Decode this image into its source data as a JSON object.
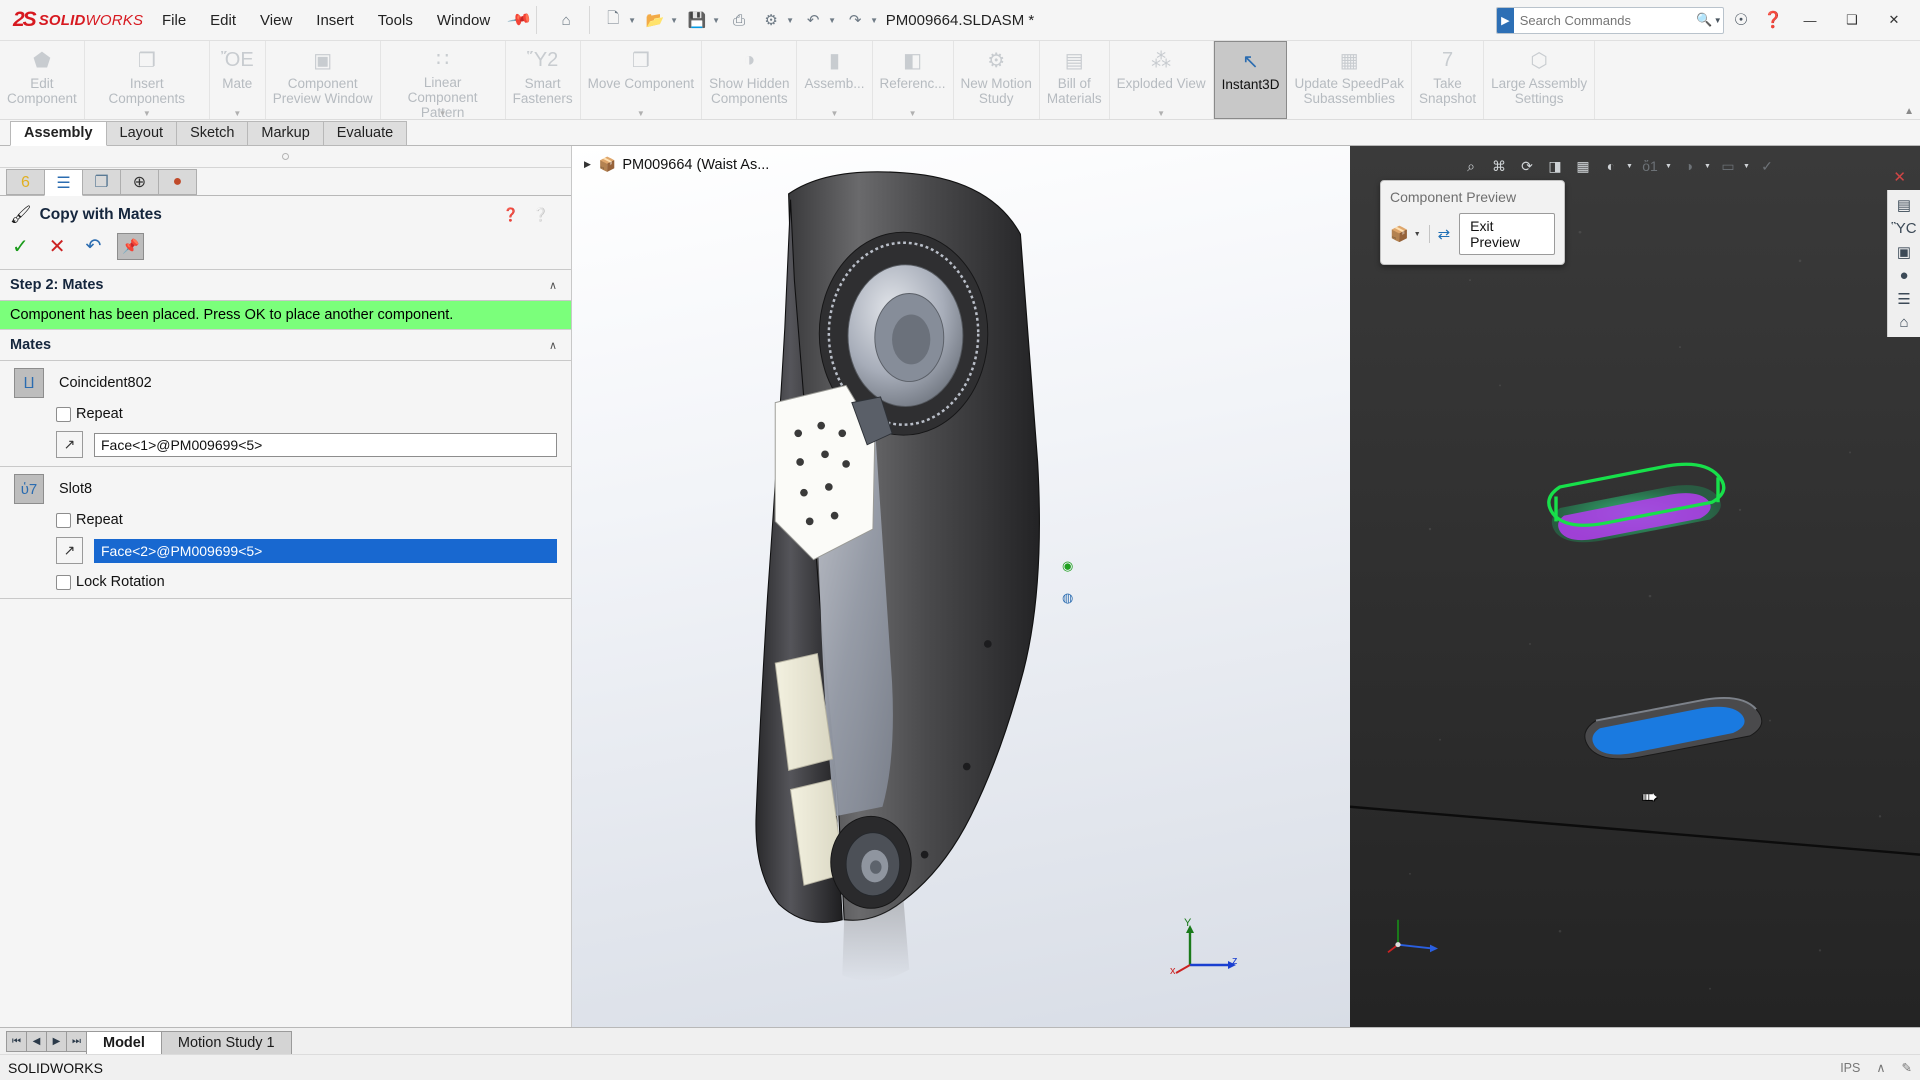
{
  "app": {
    "brand_mark": "2S",
    "brand_bold": "SOLID",
    "brand_light": "WORKS",
    "document_title": "PM009664.SLDASM *",
    "accent_color": "#d71920",
    "selection_color": "#1868d0",
    "status_color": "#7bff7b"
  },
  "menu": {
    "items": [
      {
        "label": "File"
      },
      {
        "label": "Edit"
      },
      {
        "label": "View"
      },
      {
        "label": "Insert"
      },
      {
        "label": "Tools"
      },
      {
        "label": "Window"
      }
    ],
    "pin_icon": "pushpin-icon"
  },
  "quick_access": [
    {
      "name": "home-icon",
      "glyph": "⌂",
      "caret": false
    },
    {
      "name": "new-document-icon",
      "glyph": "❐",
      "caret": true
    },
    {
      "name": "open-folder-icon",
      "glyph": "Ὄ2",
      "caret": true
    },
    {
      "name": "save-icon",
      "glyph": "ὋE",
      "caret": true
    },
    {
      "name": "print-icon",
      "glyph": "⎙",
      "caret": false
    },
    {
      "name": "options-gear-icon",
      "glyph": "⚙",
      "caret": true
    },
    {
      "name": "undo-icon",
      "glyph": "↶",
      "caret": true
    },
    {
      "name": "redo-icon",
      "glyph": "↷",
      "caret": true
    }
  ],
  "search": {
    "placeholder": "Search Commands",
    "magnifier_icon": "search-icon",
    "dropdown_icon": "chevron-down-icon",
    "go_icon": "search-go-icon"
  },
  "window_controls": {
    "account_icon": "user-account-icon",
    "help_icon": "help-icon",
    "minimize": "—",
    "maximize": "❑",
    "close": "✕"
  },
  "ribbon": {
    "buttons": [
      {
        "label": "Edit\nComponent",
        "icon": "edit-component-icon",
        "glyph": "⬟",
        "caret": false,
        "active": false
      },
      {
        "label": "Insert Components",
        "icon": "insert-components-icon",
        "glyph": "❐",
        "caret": true,
        "active": false
      },
      {
        "label": "Mate",
        "icon": "mate-icon",
        "glyph": "ὌE",
        "caret": true,
        "active": false
      },
      {
        "label": "Component\nPreview Window",
        "icon": "component-preview-window-icon",
        "glyph": "▣",
        "caret": false,
        "active": false
      },
      {
        "label": "Linear Component Pattern",
        "icon": "linear-component-pattern-icon",
        "glyph": "∷",
        "caret": true,
        "active": false
      },
      {
        "label": "Smart\nFasteners",
        "icon": "smart-fasteners-icon",
        "glyph": "Ὕ2",
        "caret": false,
        "active": false
      },
      {
        "label": "Move Component",
        "icon": "move-component-icon",
        "glyph": "❐",
        "caret": true,
        "active": false
      },
      {
        "label": "Show Hidden\nComponents",
        "icon": "show-hidden-components-icon",
        "glyph": "◑",
        "caret": false,
        "active": false
      },
      {
        "label": "Assemb...",
        "icon": "assembly-features-icon",
        "glyph": "▮",
        "caret": true,
        "active": false
      },
      {
        "label": "Referenc...",
        "icon": "reference-geometry-icon",
        "glyph": "◧",
        "caret": true,
        "active": false
      },
      {
        "label": "New Motion\nStudy",
        "icon": "new-motion-study-icon",
        "glyph": "⚙",
        "caret": false,
        "active": false
      },
      {
        "label": "Bill of\nMaterials",
        "icon": "bill-of-materials-icon",
        "glyph": "▤",
        "caret": false,
        "active": false
      },
      {
        "label": "Exploded View",
        "icon": "exploded-view-icon",
        "glyph": "⁂",
        "caret": true,
        "active": false
      },
      {
        "label": "Instant3D",
        "icon": "instant3d-icon",
        "glyph": "↖",
        "caret": false,
        "active": true
      },
      {
        "label": "Update SpeedPak\nSubassemblies",
        "icon": "update-speedpak-icon",
        "glyph": "▦",
        "caret": false,
        "active": false
      },
      {
        "label": "Take\nSnapshot",
        "icon": "take-snapshot-icon",
        "glyph": "὏7",
        "caret": false,
        "active": false
      },
      {
        "label": "Large Assembly\nSettings",
        "icon": "large-assembly-settings-icon",
        "glyph": "⬡",
        "caret": false,
        "active": false
      }
    ],
    "collapse_icon": "chevron-up-icon"
  },
  "command_tabs": [
    {
      "label": "Assembly",
      "selected": true
    },
    {
      "label": "Layout",
      "selected": false
    },
    {
      "label": "Sketch",
      "selected": false
    },
    {
      "label": "Markup",
      "selected": false
    },
    {
      "label": "Evaluate",
      "selected": false
    }
  ],
  "property_manager": {
    "tabs": [
      {
        "name": "feature-manager-tree-tab",
        "glyph": "὎6",
        "selected": false
      },
      {
        "name": "property-manager-tab",
        "glyph": "☰",
        "selected": true
      },
      {
        "name": "configuration-manager-tab",
        "glyph": "❐",
        "selected": false
      },
      {
        "name": "dimxpert-manager-tab",
        "glyph": "⊕",
        "selected": false
      },
      {
        "name": "display-manager-tab",
        "glyph": "●",
        "selected": false
      }
    ],
    "title": "Copy with Mates",
    "title_icon": "copy-with-mates-icon",
    "help_icons": [
      "help-question-icon",
      "whats-wrong-icon"
    ],
    "actions": {
      "ok": "✓",
      "cancel": "✕",
      "undo": "↶",
      "pin": "ὌC"
    },
    "step_section": {
      "title": "Step 2: Mates",
      "chevron": "∧",
      "message": "Component has been placed. Press OK to place another component."
    },
    "mates_section": {
      "title": "Mates",
      "chevron": "∧",
      "mates": [
        {
          "name": "Coincident802",
          "icon": "coincident-mate-icon",
          "glyph": "⨿",
          "repeat_label": "Repeat",
          "repeat_checked": false,
          "reference": "Face<1>@PM009699<5>",
          "reference_selected": false,
          "lock_rotation_label": null,
          "lock_rotation_checked": false
        },
        {
          "name": "Slot8",
          "icon": "slot-mate-icon",
          "glyph": "ὑ7",
          "repeat_label": "Repeat",
          "repeat_checked": false,
          "reference": "Face<2>@PM009699<5>",
          "reference_selected": true,
          "lock_rotation_label": "Lock Rotation",
          "lock_rotation_checked": false
        }
      ]
    }
  },
  "graphics": {
    "tree_root": "PM009664 (Waist As...",
    "tree_root_icon": "assembly-icon",
    "expand_icon": "triangle-right-icon",
    "triad": {
      "x": "x",
      "y": "Y",
      "z": "z"
    },
    "badges": [
      {
        "name": "mate-badge-green",
        "glyph": "◉"
      },
      {
        "name": "mate-badge-blue",
        "glyph": "◍"
      }
    ]
  },
  "preview_pane": {
    "toolbar": [
      {
        "name": "zoom-to-fit-icon",
        "glyph": "⌕",
        "dim": false,
        "caret": false
      },
      {
        "name": "zoom-to-area-icon",
        "glyph": "⌘",
        "dim": false,
        "caret": false
      },
      {
        "name": "rotate-view-icon",
        "glyph": "⟳",
        "dim": false,
        "caret": false
      },
      {
        "name": "section-view-icon",
        "glyph": "◨",
        "dim": false,
        "caret": false
      },
      {
        "name": "view-orientation-icon",
        "glyph": "▦",
        "dim": false,
        "caret": false
      },
      {
        "name": "display-style-icon",
        "glyph": "◐",
        "dim": false,
        "caret": true
      },
      {
        "name": "hide-show-items-icon",
        "glyph": "ὄ1",
        "dim": true,
        "caret": true
      },
      {
        "name": "edit-appearance-icon",
        "glyph": "◑",
        "dim": true,
        "caret": true
      },
      {
        "name": "apply-scene-icon",
        "glyph": "▭",
        "dim": true,
        "caret": true
      },
      {
        "name": "view-settings-icon",
        "glyph": "✓",
        "dim": true,
        "caret": false
      }
    ],
    "close_icon": "close-preview-icon",
    "right_rail": [
      {
        "name": "display-manager-rail-icon",
        "glyph": "▤"
      },
      {
        "name": "appearances-rail-icon",
        "glyph": "ὛC"
      },
      {
        "name": "scenes-rail-icon",
        "glyph": "▣"
      },
      {
        "name": "decals-rail-icon",
        "glyph": "●"
      },
      {
        "name": "lights-rail-icon",
        "glyph": "☰"
      },
      {
        "name": "home-rail-icon",
        "glyph": "⌂"
      }
    ],
    "dialog": {
      "title": "Component Preview",
      "component_icon": "component-color-icon",
      "caret_icon": "chevron-down-icon",
      "refresh_icon": "synchronize-icon",
      "exit_label": "Exit Preview"
    },
    "cursor_icon": "mouse-pointer-icon"
  },
  "bottom": {
    "nav_buttons": [
      {
        "name": "first-page-button",
        "glyph": "⏮"
      },
      {
        "name": "previous-page-button",
        "glyph": "◀"
      },
      {
        "name": "next-page-button",
        "glyph": "▶"
      },
      {
        "name": "last-page-button",
        "glyph": "⏭"
      }
    ],
    "tabs": [
      {
        "label": "Model",
        "selected": true
      },
      {
        "label": "Motion Study 1",
        "selected": false
      }
    ]
  },
  "status": {
    "text": "SOLIDWORKS",
    "units": "IPS",
    "caret": "∧",
    "edit_icon": "✎"
  }
}
